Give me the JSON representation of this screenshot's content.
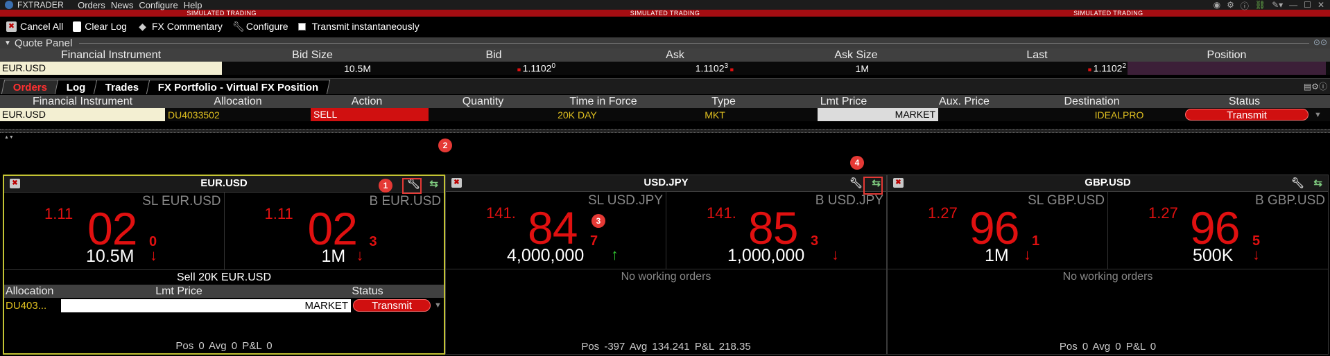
{
  "titlebar": {
    "app": "FXTRADER",
    "menus": [
      "Orders",
      "News",
      "Configure",
      "Help"
    ]
  },
  "sim_banner": [
    "SIMULATED TRADING",
    "SIMULATED TRADING",
    "SIMULATED TRADING"
  ],
  "toolbar": {
    "cancel_all": "Cancel All",
    "clear_log": "Clear Log",
    "fx_commentary": "FX Commentary",
    "configure": "Configure",
    "transmit_instant": "Transmit instantaneously"
  },
  "quote_panel": {
    "title": "Quote Panel",
    "headers": [
      "Financial Instrument",
      "Bid Size",
      "Bid",
      "Ask",
      "Ask Size",
      "Last",
      "Position"
    ],
    "row": {
      "instrument": "EUR.USD",
      "bid_size": "10.5M",
      "bid": "1.1102",
      "bid_sup": "0",
      "ask": "1.1102",
      "ask_sup": "3",
      "ask_size": "1M",
      "last": "1.1102",
      "last_sup": "2",
      "position": ""
    }
  },
  "orders": {
    "tabs": [
      "Orders",
      "Log",
      "Trades",
      "FX Portfolio - Virtual FX Position"
    ],
    "headers": [
      "Financial Instrument",
      "Allocation",
      "Action",
      "Quantity",
      "Time in Force",
      "Type",
      "Lmt Price",
      "Aux. Price",
      "Destination",
      "Status"
    ],
    "row": {
      "instrument": "EUR.USD",
      "allocation": "DU4033502",
      "action": "SELL",
      "quantity": "20K",
      "tif": "DAY",
      "type": "MKT",
      "lmt": "MARKET",
      "aux": "",
      "destination": "IDEALPRO",
      "status": "Transmit"
    }
  },
  "cards": [
    {
      "pair": "EUR.USD",
      "sell_label": "SL EUR.USD",
      "buy_label": "B EUR.USD",
      "sell": {
        "pre": "1.11",
        "big": "02",
        "pip": "0",
        "size": "10.5M",
        "dir": "↓"
      },
      "buy": {
        "pre": "1.11",
        "big": "02",
        "pip": "3",
        "size": "1M",
        "dir": "↓"
      },
      "order_summary": "Sell 20K EUR.USD",
      "order_headers": [
        "Allocation",
        "Lmt Price",
        "Status"
      ],
      "order_row": {
        "alloc": "DU403...",
        "lmt": "MARKET",
        "status": "Transmit"
      },
      "footer": "Pos  0   Avg  0   P&L  0"
    },
    {
      "pair": "USD.JPY",
      "sell_label": "SL USD.JPY",
      "buy_label": "B USD.JPY",
      "sell": {
        "pre": "141.",
        "big": "84",
        "pip": "7",
        "size": "4,000,000",
        "dir": "↑"
      },
      "buy": {
        "pre": "141.",
        "big": "85",
        "pip": "3",
        "size": "1,000,000",
        "dir": "↓"
      },
      "no_orders": "No working orders",
      "footer": "Pos  -397   Avg  134.241   P&L  218.35"
    },
    {
      "pair": "GBP.USD",
      "sell_label": "SL GBP.USD",
      "buy_label": "B GBP.USD",
      "sell": {
        "pre": "1.27",
        "big": "96",
        "pip": "1",
        "size": "1M",
        "dir": "↓"
      },
      "buy": {
        "pre": "1.27",
        "big": "96",
        "pip": "5",
        "size": "500K",
        "dir": "↓"
      },
      "no_orders": "No working orders",
      "footer": "Pos  0   Avg  0   P&L  0"
    }
  ],
  "callouts": [
    "1",
    "2",
    "3",
    "4"
  ]
}
